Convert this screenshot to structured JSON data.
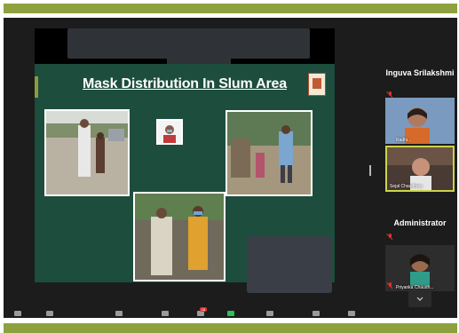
{
  "slide": {
    "title": "Mask Distribution In Slum Area"
  },
  "participants": [
    {
      "display_name": "Inguva Srilakshmi",
      "muted": true,
      "video": false
    },
    {
      "display_name": "Radhi...",
      "muted": false,
      "video": true
    },
    {
      "display_name": "Sejal Chaudhary",
      "muted": false,
      "video": true,
      "active_speaker": true
    },
    {
      "display_name": "Administrator",
      "muted": true,
      "video": false
    },
    {
      "display_name": "Priyanka Chaudh...",
      "muted": true,
      "video": true
    }
  ],
  "toolbar": {
    "chat_badge": "18"
  },
  "colors": {
    "header_band": "#8da23e",
    "slide_background": "#1d4d3d",
    "active_speaker_border": "#c9d44b",
    "muted_icon": "#e0302c"
  },
  "icons": [
    "mic-muted-icon",
    "chevron-down-icon",
    "leaf-logo-icon"
  ]
}
